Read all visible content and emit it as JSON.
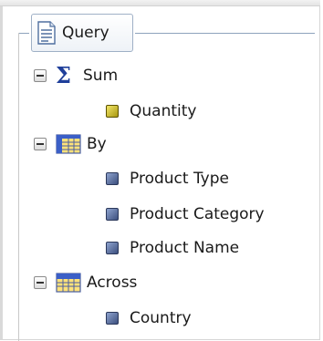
{
  "panel": {
    "tab_label": "Query"
  },
  "tree": {
    "sum": {
      "label": "Sum",
      "icon": "sigma-icon",
      "items": [
        {
          "label": "Quantity"
        }
      ]
    },
    "by": {
      "label": "By",
      "icon": "grid-icon",
      "items": [
        {
          "label": "Product Type"
        },
        {
          "label": "Product Category"
        },
        {
          "label": "Product Name"
        }
      ]
    },
    "across": {
      "label": "Across",
      "icon": "grid-icon",
      "items": [
        {
          "label": "Country"
        }
      ]
    }
  },
  "colors": {
    "measure": "#d6c72a",
    "dimension": "#5a6d9c",
    "sigma": "#1f3f9a",
    "group_border": "#8ea3bd"
  }
}
